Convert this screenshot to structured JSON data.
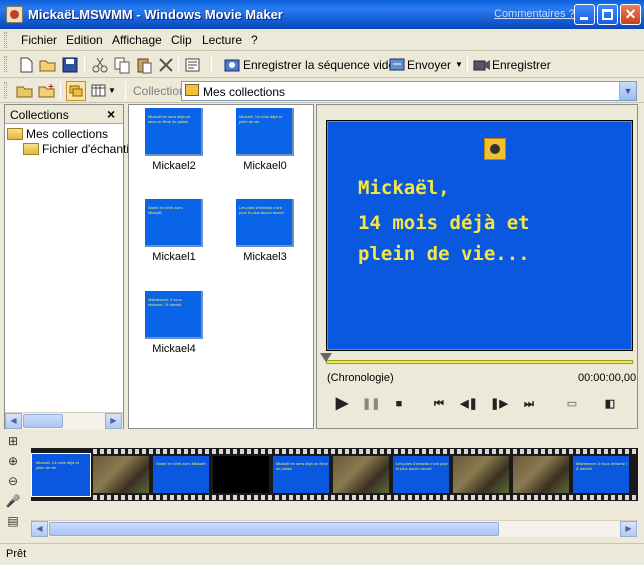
{
  "window": {
    "title": "MickaëLMSWMM - Windows Movie Maker",
    "help_link": "Commentaires ?"
  },
  "menu": [
    "Fichier",
    "Edition",
    "Affichage",
    "Clip",
    "Lecture",
    "?"
  ],
  "toolbar": {
    "save_video": "Enregistrer la séquence vidéo",
    "send": "Envoyer",
    "record": "Enregistrer"
  },
  "collection_bar": {
    "label": "Collection",
    "selected": "Mes collections"
  },
  "collections_pane": {
    "title": "Collections",
    "close": "×",
    "tree": [
      "Mes collections",
      "Fichier d'échantillo"
    ]
  },
  "clips": [
    {
      "label": "Mickael2",
      "text": "Mickaël en sera déjà un sera un filme de plaisir"
    },
    {
      "label": "Mickael0",
      "text": "Mickaël, 14 mois déjà et plein de vie"
    },
    {
      "label": "Mickael1",
      "text": "Santé en forth avec Mickaël"
    },
    {
      "label": "Mickael3",
      "text": "Les joies d'enfants n'ont pour le plus aucun secret"
    },
    {
      "label": "Mickael4",
      "text": "Maintenant, il nous réclame ! À bientôt"
    }
  ],
  "preview": {
    "lines": [
      "Mickaël,",
      "14 mois déjà et",
      "plein de vie..."
    ],
    "status": "(Chronologie)",
    "time": "00:00:00,00"
  },
  "storyboard": {
    "first_text": "Mickaël, 14 mois déjà et plein de vie",
    "frames": [
      {
        "type": "photo"
      },
      {
        "type": "blue",
        "text": "Santé en forth avec Mickaël"
      },
      {
        "type": "black"
      },
      {
        "type": "blue",
        "text": "Mickaël en sera déjà un filme de plaisir"
      },
      {
        "type": "photo"
      },
      {
        "type": "blue",
        "text": "Les joies d'enfants n'ont pour le plus aucun secret"
      },
      {
        "type": "photo"
      },
      {
        "type": "photo"
      },
      {
        "type": "blue",
        "text": "Maintenant, il nous réclame ! À bientôt"
      }
    ]
  },
  "status": "Prêt"
}
